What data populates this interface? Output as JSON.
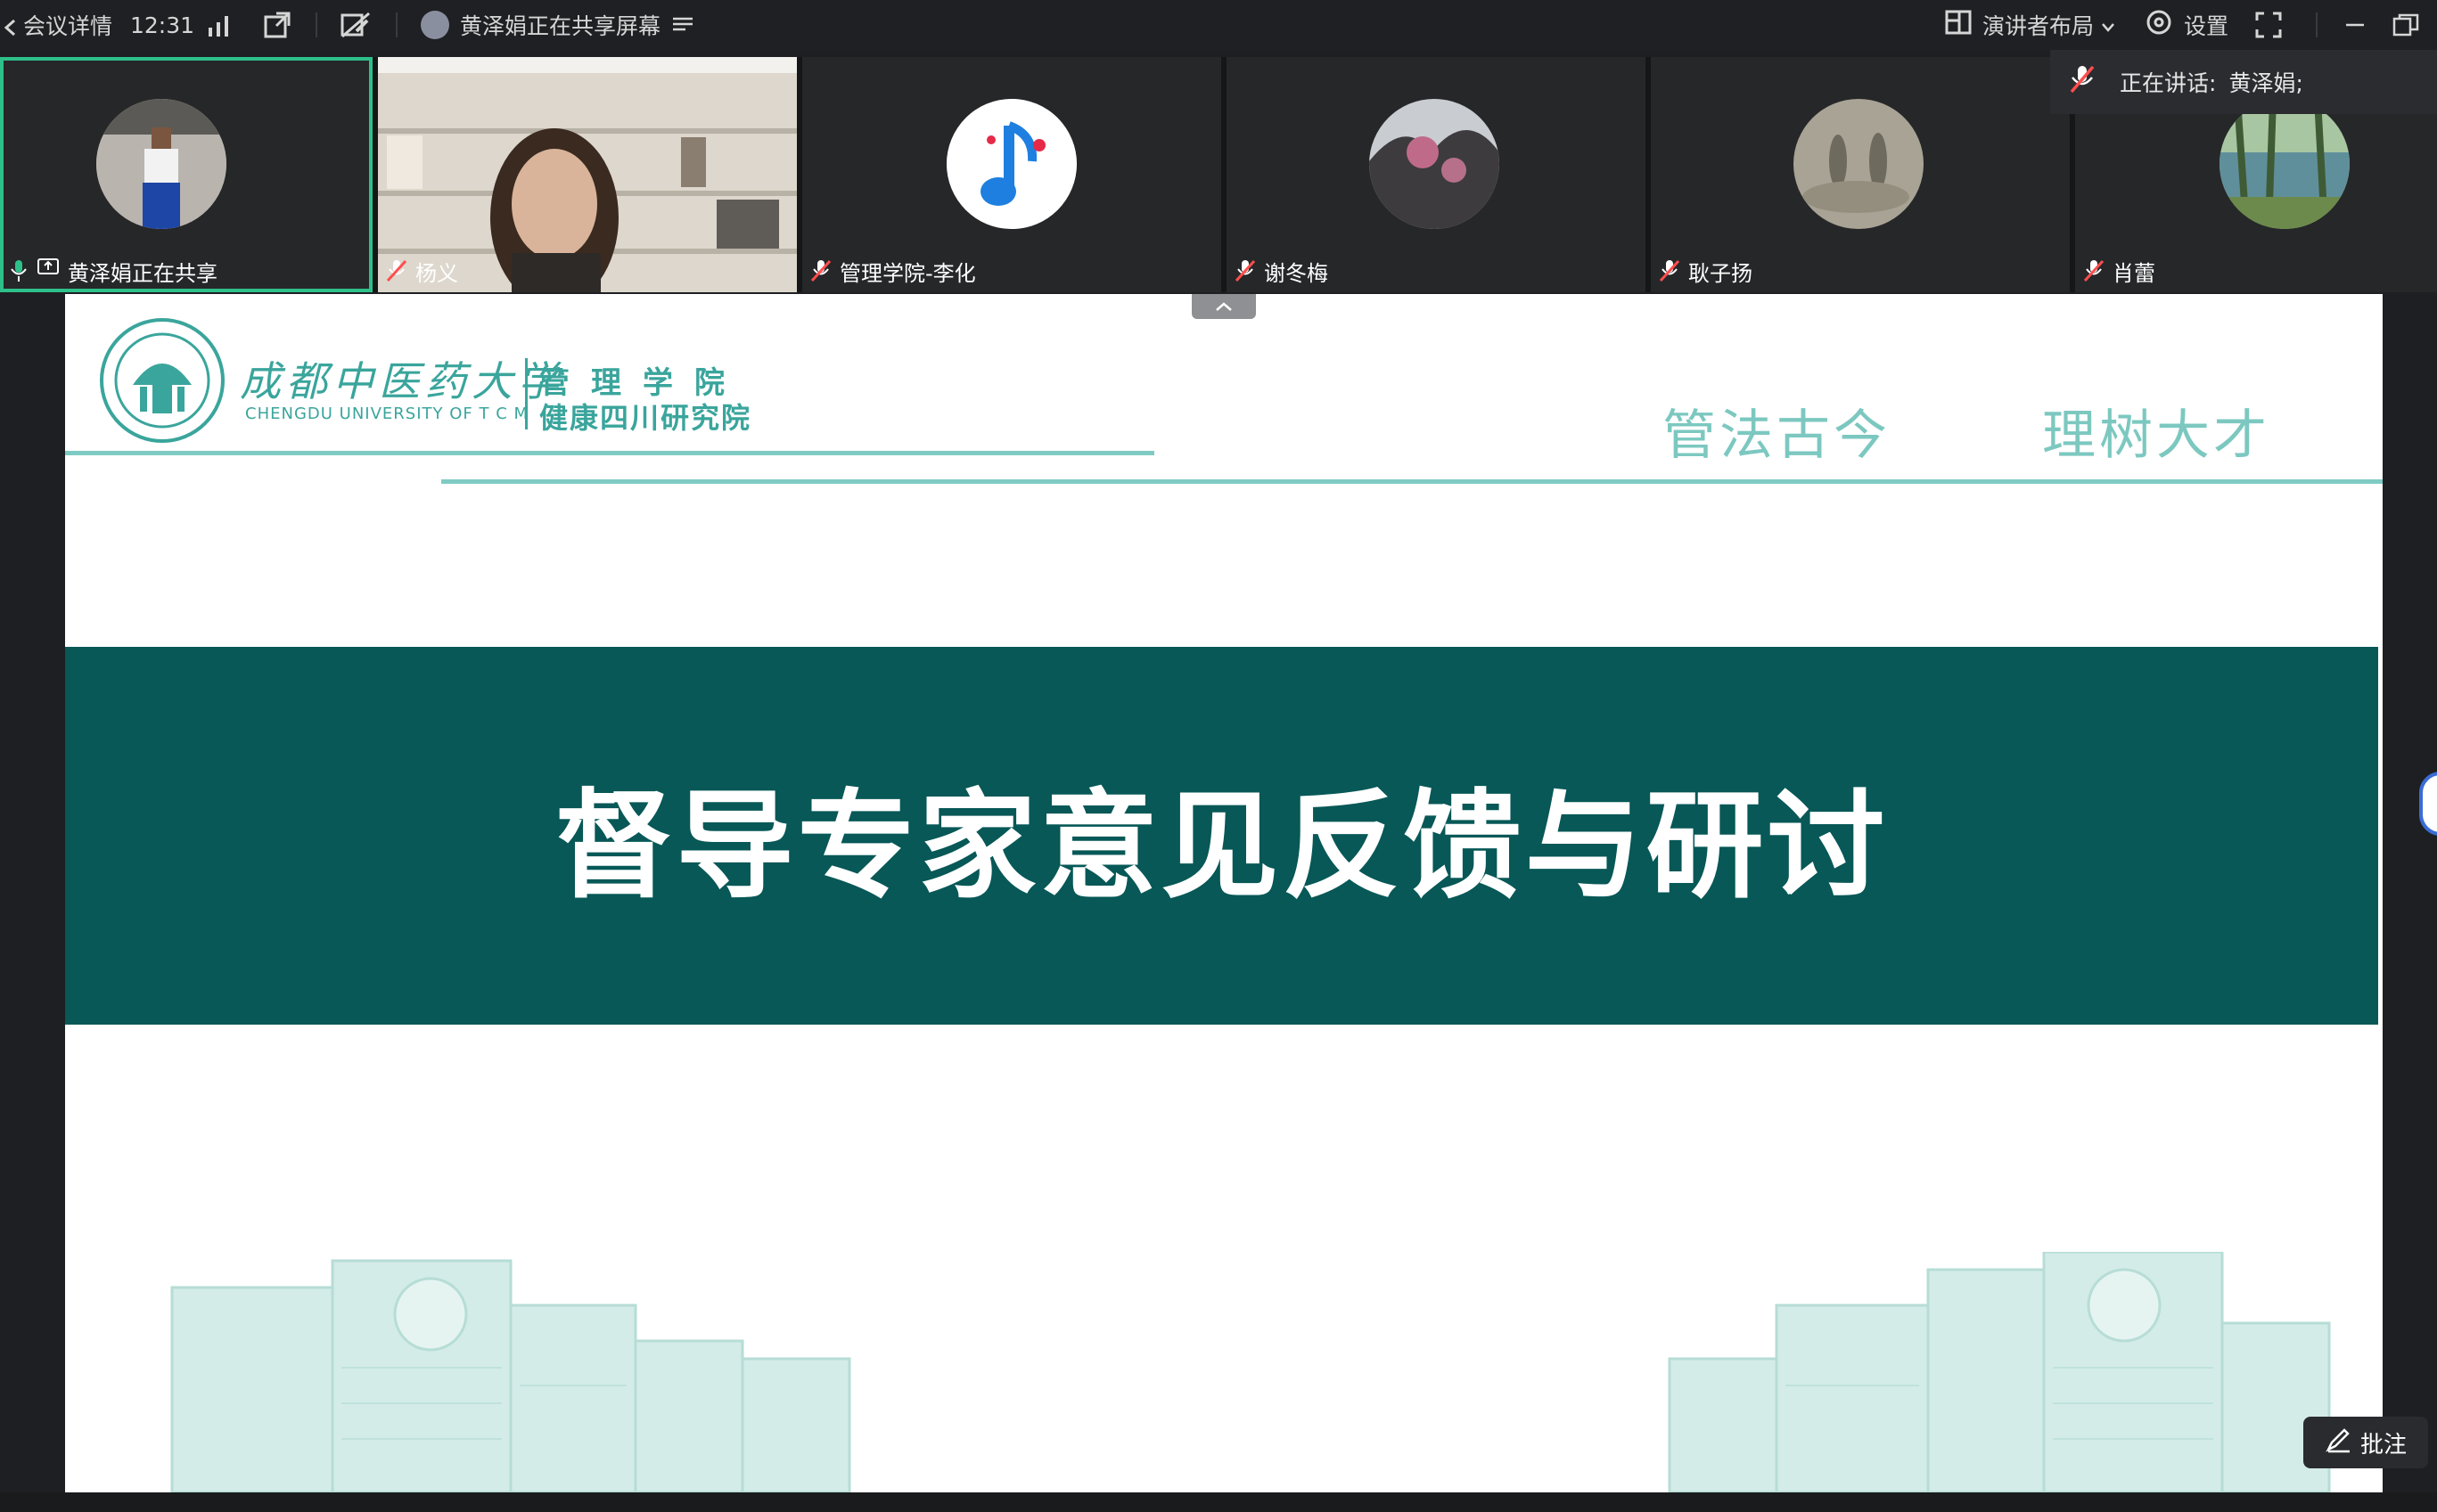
{
  "topbar": {
    "meeting_details": "会议详情",
    "time": "12:31",
    "sharing_status": "黄泽娟正在共享屏幕",
    "layout_label": "演讲者布局",
    "settings_label": "设置"
  },
  "speaking": {
    "prefix": "正在讲话:",
    "name": "黄泽娟;"
  },
  "participants": [
    {
      "name": "黄泽娟正在共享"
    },
    {
      "name": "杨义"
    },
    {
      "name": "管理学院-李化"
    },
    {
      "name": "谢冬梅"
    },
    {
      "name": "耿子扬"
    },
    {
      "name": "肖蕾"
    }
  ],
  "slide": {
    "university_cn": "成都中医药大学",
    "university_en": "CHENGDU UNIVERSITY OF T C M",
    "dept_line1": "管理学院",
    "dept_line2": "健康四川研究院",
    "motto_left": "管法古今",
    "motto_right": "理树大才",
    "title": "督导专家意见反馈与研讨"
  },
  "annotate_label": "批注",
  "colors": {
    "teal_banner": "#075857",
    "teal_light": "#7fcbc4",
    "active_border": "#2ec08a"
  }
}
